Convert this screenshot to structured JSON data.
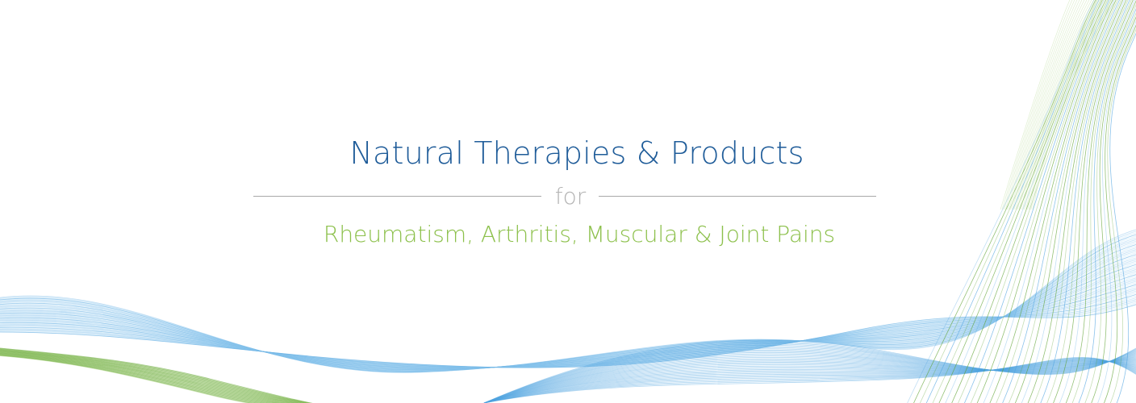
{
  "banner": {
    "title": "Natural Therapies & Products",
    "connector": "for",
    "subtitle": "Rheumatism, Arthritis, Muscular & Joint Pains"
  },
  "colors": {
    "title": "#1f5c99",
    "connector": "#b3b3b3",
    "subtitle": "#8cc04b",
    "wave_blue": "#4fa3e0",
    "wave_light_blue": "#9fd0f2",
    "wave_green": "#5aa02c",
    "wave_light_green": "#a7d07a"
  }
}
